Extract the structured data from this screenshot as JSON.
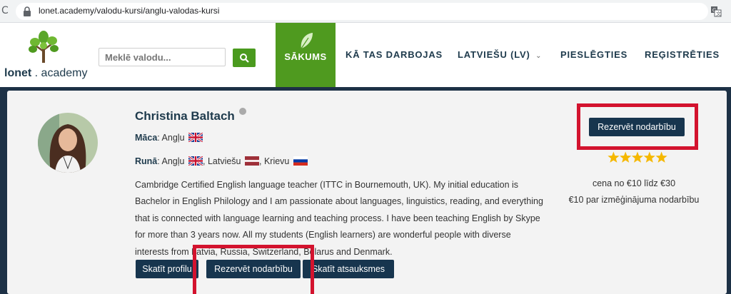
{
  "browser": {
    "url": "lonet.academy/valodu-kursi/anglu-valodas-kursi"
  },
  "header": {
    "logo_bold": "lonet",
    "logo_rest": " . academy",
    "search_placeholder": "Meklē valodu...",
    "nav": [
      {
        "label": "SĀKUMS"
      },
      {
        "label": "KĀ TAS DARBOJAS"
      },
      {
        "label": "LATVIEŠU (LV)"
      },
      {
        "label": "PIESLĒGTIES"
      },
      {
        "label": "REĢISTRĒTIES"
      }
    ]
  },
  "teacher": {
    "name": "Christina Baltach",
    "teaches_label": "Māca",
    "teaches_value": "Angļu",
    "speaks_label": "Runā",
    "speaks": [
      "Angļu",
      "Latviešu",
      "Krievu"
    ],
    "bio": "Cambridge Certified English language teacher (ITTC in Bournemouth, UK). My initial education is Bachelor in English Philology and I am passionate about languages, linguistics, reading, and everything that is connected with language learning and teaching process. I have been teaching English by Skype for more than 3 years now. All my students (English learners) are wonderful people with diverse interests from Latvia, Russia, Switzerland, Belarus and Denmark.",
    "rating_stars": 5,
    "price_range": "cena no €10 līdz €30",
    "trial_price": "€10 par izmēģinājuma nodarbību"
  },
  "actions": {
    "book_top": "Rezervēt nodarbību",
    "view_profile": "Skatīt profilu",
    "book_bottom": "Rezervēt nodarbību",
    "view_reviews": "Skatīt atsauksmes"
  },
  "colors": {
    "brand_green": "#4f9a1f",
    "navy": "#17354e",
    "highlight_red": "#d3132e",
    "star": "#f5b800"
  }
}
